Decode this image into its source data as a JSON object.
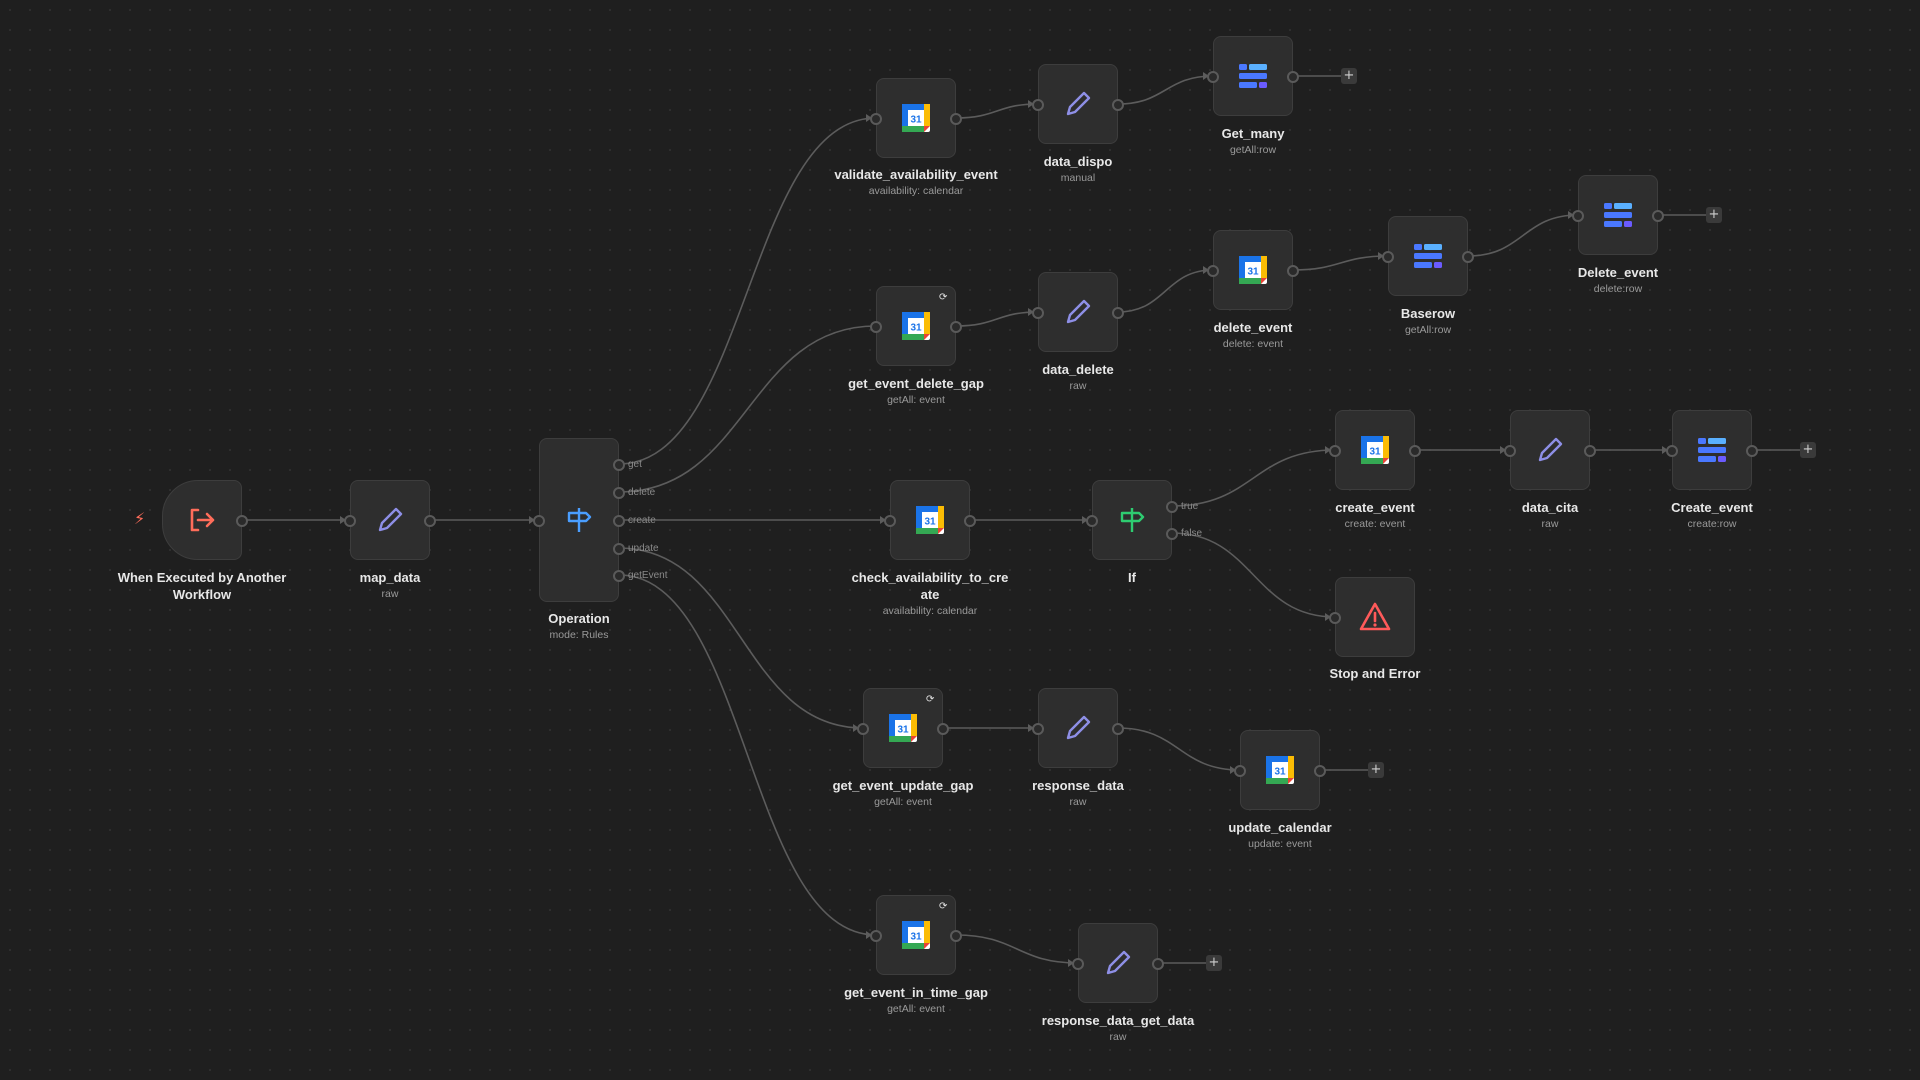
{
  "colors": {
    "canvas": "#1f1f1f",
    "node": "#2e2e2e",
    "edge": "#5c5c5c",
    "trigger_accent": "#ff6d5a",
    "edit_icon": "#8e8fe6",
    "switch_icon": "#4a9eff",
    "if_icon": "#2ecc71",
    "error_icon": "#ff5a5a",
    "baserow_icon": "#4a78ff"
  },
  "nodes": {
    "trigger": {
      "title": "When Executed by Another Workflow",
      "subtitle": "",
      "icon": "sign-in-icon"
    },
    "map_data": {
      "title": "map_data",
      "subtitle": "raw",
      "icon": "pencil-icon"
    },
    "operation": {
      "title": "Operation",
      "subtitle": "mode: Rules",
      "icon": "signpost-icon",
      "outputs": [
        "get",
        "delete",
        "create",
        "update",
        "getEvent"
      ]
    },
    "validate_availability_event": {
      "title": "validate_availability_event",
      "subtitle": "availability: calendar",
      "icon": "google-calendar-icon"
    },
    "data_dispo": {
      "title": "data_dispo",
      "subtitle": "manual",
      "icon": "pencil-icon"
    },
    "get_many": {
      "title": "Get_many",
      "subtitle": "getAll:row",
      "icon": "baserow-icon"
    },
    "get_event_delete_gap": {
      "title": "get_event_delete_gap",
      "subtitle": "getAll: event",
      "icon": "google-calendar-icon"
    },
    "data_delete": {
      "title": "data_delete",
      "subtitle": "raw",
      "icon": "pencil-icon"
    },
    "delete_event": {
      "title": "delete_event",
      "subtitle": "delete: event",
      "icon": "google-calendar-icon"
    },
    "baserow": {
      "title": "Baserow",
      "subtitle": "getAll:row",
      "icon": "baserow-icon"
    },
    "delete_event_row": {
      "title": "Delete_event",
      "subtitle": "delete:row",
      "icon": "baserow-icon"
    },
    "check_availability_to_create": {
      "title": "check_availability_to_create",
      "subtitle": "availability: calendar",
      "icon": "google-calendar-icon"
    },
    "if": {
      "title": "If",
      "subtitle": "",
      "icon": "signpost-icon",
      "outputs": [
        "true",
        "false"
      ]
    },
    "create_event": {
      "title": "create_event",
      "subtitle": "create: event",
      "icon": "google-calendar-icon"
    },
    "data_cita": {
      "title": "data_cita",
      "subtitle": "raw",
      "icon": "pencil-icon"
    },
    "create_event_row": {
      "title": "Create_event",
      "subtitle": "create:row",
      "icon": "baserow-icon"
    },
    "stop_and_error": {
      "title": "Stop and Error",
      "subtitle": "",
      "icon": "warning-icon"
    },
    "get_event_update_gap": {
      "title": "get_event_update_gap",
      "subtitle": "getAll: event",
      "icon": "google-calendar-icon"
    },
    "response_data": {
      "title": "response_data",
      "subtitle": "raw",
      "icon": "pencil-icon"
    },
    "update_calendar": {
      "title": "update_calendar",
      "subtitle": "update: event",
      "icon": "google-calendar-icon"
    },
    "get_event_in_time_gap": {
      "title": "get_event_in_time_gap",
      "subtitle": "getAll: event",
      "icon": "google-calendar-icon"
    },
    "response_data_get_data": {
      "title": "response_data_get_data",
      "subtitle": "raw",
      "icon": "pencil-icon"
    }
  },
  "add_button_label": "+",
  "sync_badge": "⟳"
}
